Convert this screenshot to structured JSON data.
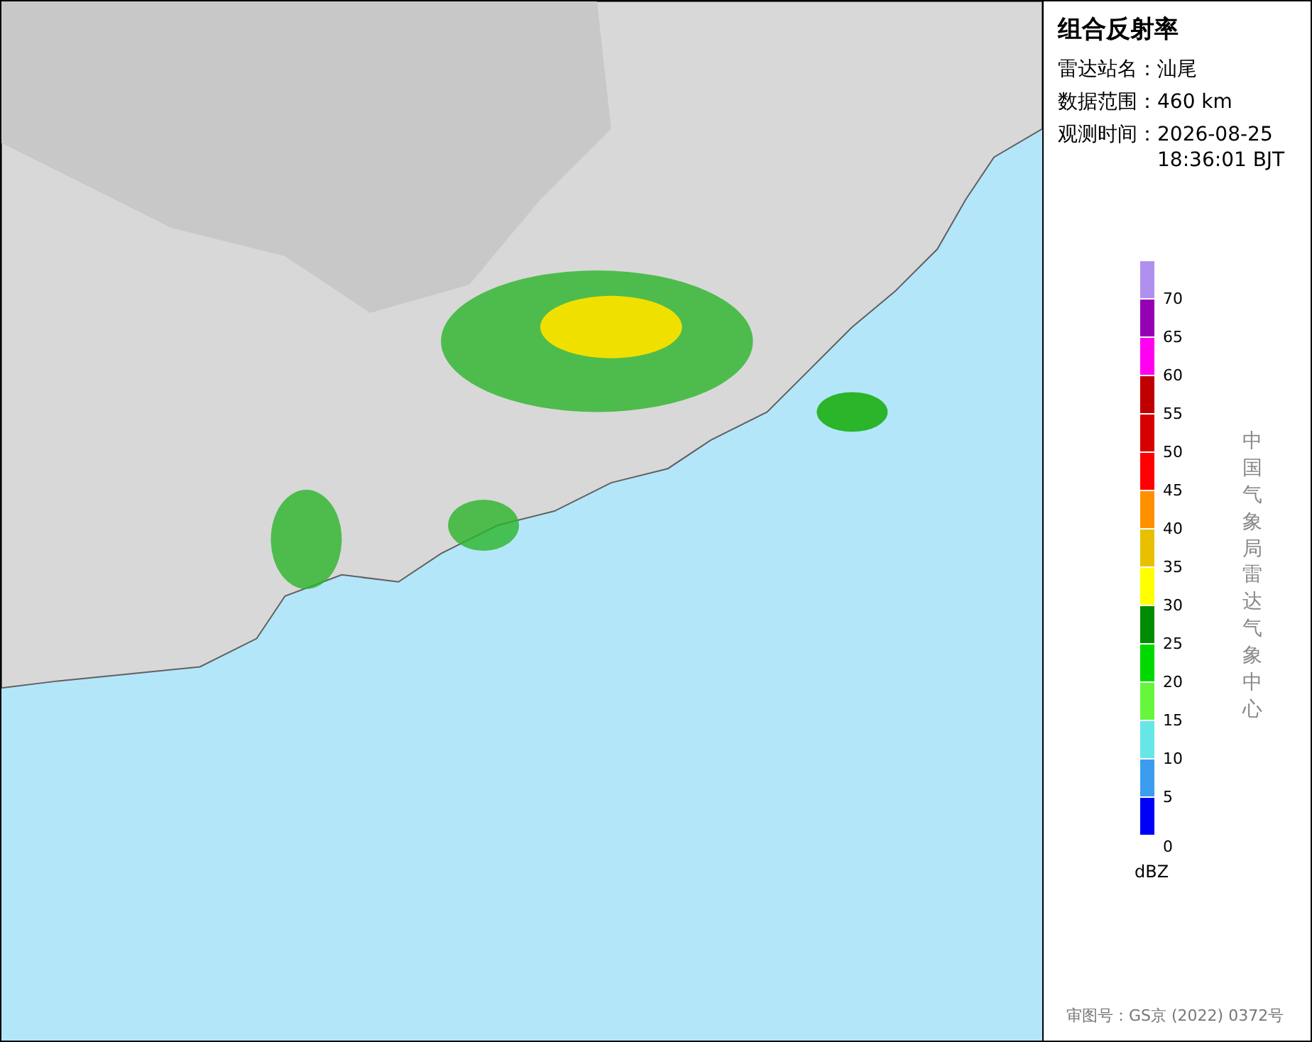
{
  "panel": {
    "title": "组合反射率",
    "fields": [
      {
        "label": "雷达站名：",
        "value": "汕尾"
      },
      {
        "label": "数据范围：",
        "value": "460 km"
      },
      {
        "label": "观测时间：",
        "value": "2026-08-25 18:36:01 BJT"
      }
    ]
  },
  "legend": {
    "unit": "dBZ",
    "segments": [
      {
        "color": "#b090ee"
      },
      {
        "label": "70",
        "color": "#9600b4"
      },
      {
        "label": "65",
        "color": "#ff00f0"
      },
      {
        "label": "60",
        "color": "#c00000"
      },
      {
        "label": "55",
        "color": "#d60000"
      },
      {
        "label": "50",
        "color": "#ff0000"
      },
      {
        "label": "45",
        "color": "#ff9000"
      },
      {
        "label": "40",
        "color": "#e8c000"
      },
      {
        "label": "35",
        "color": "#ffff00"
      },
      {
        "label": "30",
        "color": "#008c00"
      },
      {
        "label": "25",
        "color": "#00d800"
      },
      {
        "label": "20",
        "color": "#66f63c"
      },
      {
        "label": "15",
        "color": "#66e6e6"
      },
      {
        "label": "10",
        "color": "#3c9cf0"
      },
      {
        "label": "5",
        "color": "#0000f6"
      }
    ],
    "bottom_label": "0"
  },
  "credit": "中国气象局雷达气象中心",
  "approval": "审图号：GS京 (2022) 0372号"
}
